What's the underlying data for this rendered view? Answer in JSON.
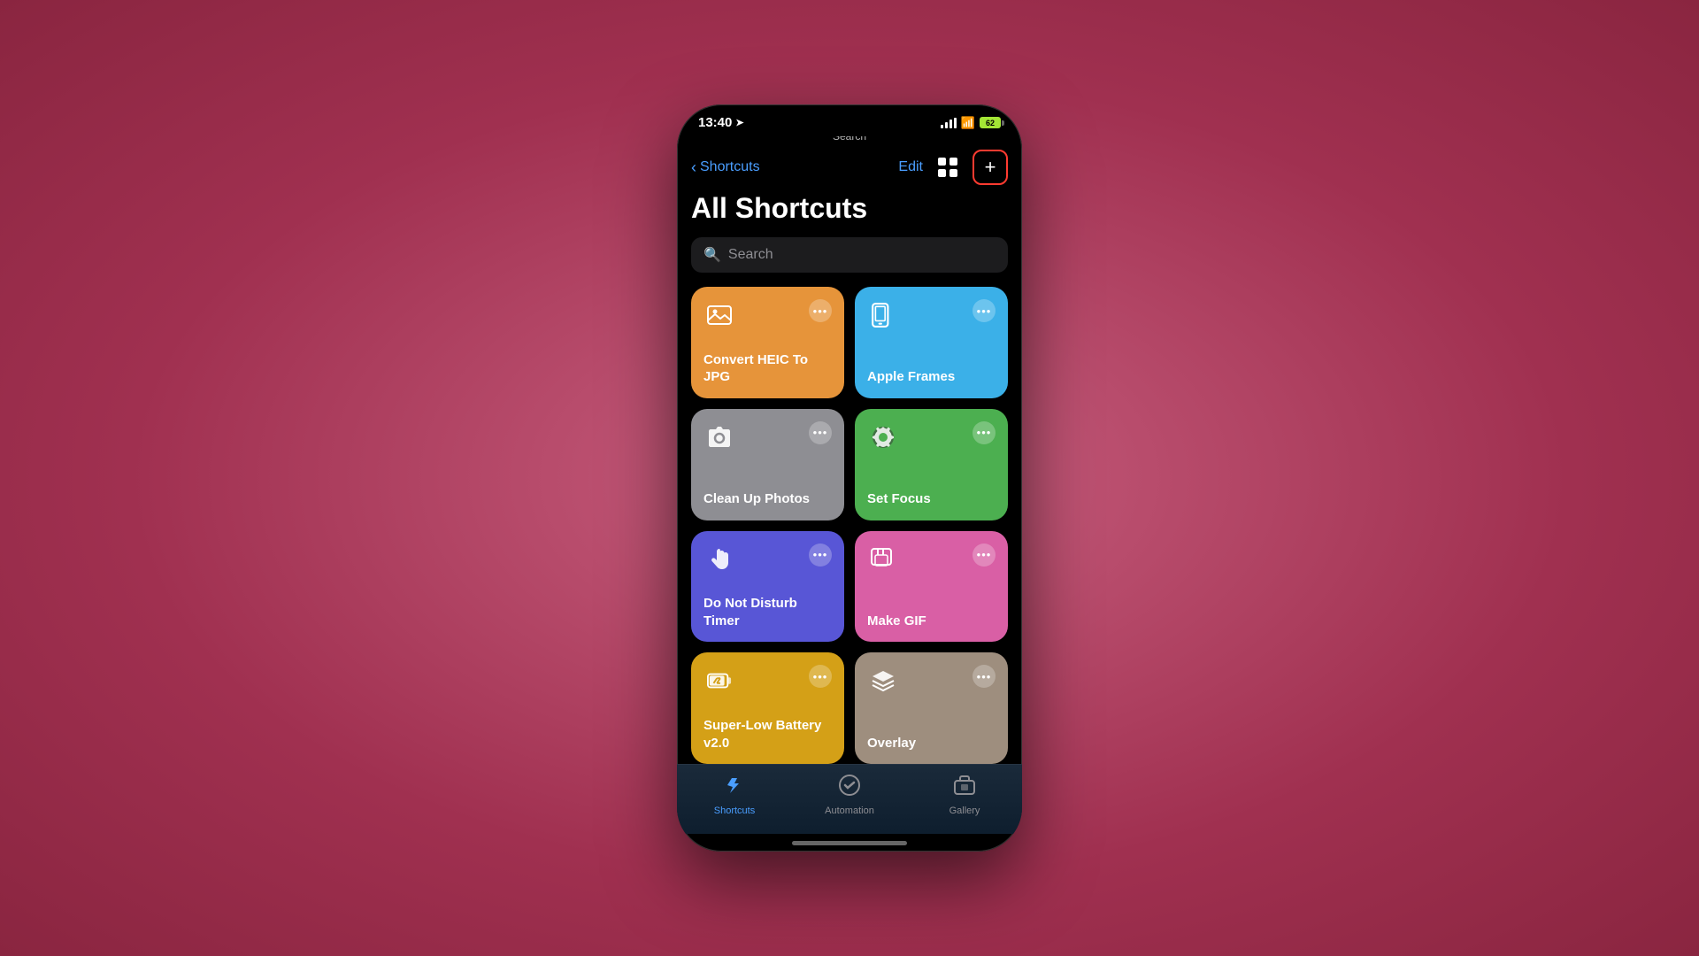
{
  "phone": {
    "statusBar": {
      "time": "13:40",
      "locationIcon": "▶",
      "backLabel": "Search",
      "batteryLevel": "62"
    },
    "navBar": {
      "backLabel": "Shortcuts",
      "editLabel": "Edit",
      "addButtonLabel": "+"
    },
    "pageTitle": "All Shortcuts",
    "searchBar": {
      "placeholder": "Search"
    },
    "shortcuts": [
      {
        "id": "convert-heic",
        "title": "Convert HEIC To JPG",
        "color": "card-orange",
        "icon": "photo",
        "iconSymbol": "🖼"
      },
      {
        "id": "apple-frames",
        "title": "Apple Frames",
        "color": "card-blue",
        "icon": "grid",
        "iconSymbol": "⊞"
      },
      {
        "id": "clean-up-photos",
        "title": "Clean Up Photos",
        "color": "card-gray",
        "icon": "camera",
        "iconSymbol": "📷"
      },
      {
        "id": "set-focus",
        "title": "Set Focus",
        "color": "card-green",
        "icon": "gear",
        "iconSymbol": "⚙"
      },
      {
        "id": "do-not-disturb",
        "title": "Do Not Disturb Timer",
        "color": "card-purple",
        "icon": "hand",
        "iconSymbol": "✋"
      },
      {
        "id": "make-gif",
        "title": "Make GIF",
        "color": "card-pink",
        "icon": "gif",
        "iconSymbol": "🖼"
      },
      {
        "id": "super-low-battery",
        "title": "Super-Low Battery v2.0",
        "color": "card-yellow",
        "icon": "battery",
        "iconSymbol": "🔋"
      },
      {
        "id": "overlay",
        "title": "Overlay",
        "color": "card-tan",
        "icon": "layers",
        "iconSymbol": "◈"
      }
    ],
    "tabs": [
      {
        "id": "shortcuts",
        "label": "Shortcuts",
        "icon": "◈",
        "active": true
      },
      {
        "id": "automation",
        "label": "Automation",
        "icon": "✓",
        "active": false
      },
      {
        "id": "gallery",
        "label": "Gallery",
        "icon": "🏪",
        "active": false
      }
    ]
  }
}
